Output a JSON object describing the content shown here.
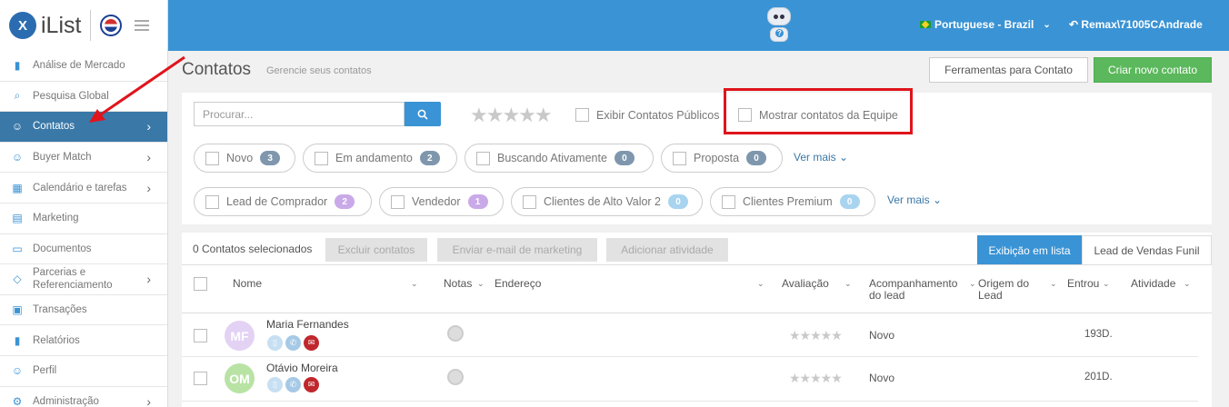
{
  "brand": {
    "logo_text": "iList",
    "logo_mark": "X"
  },
  "topbar": {
    "language": "Portuguese - Brazil",
    "user": "Remax\\71005CAndrade",
    "accent": "#3a93d4"
  },
  "sidebar": {
    "items": [
      {
        "label": "Análise de Mercado",
        "icon": "bar-chart-icon",
        "has_arrow": false
      },
      {
        "label": "Pesquisa Global",
        "icon": "search-icon",
        "has_arrow": false
      },
      {
        "label": "Contatos",
        "icon": "contacts-icon",
        "has_arrow": true,
        "active": true
      },
      {
        "label": "Buyer Match",
        "icon": "user-icon",
        "has_arrow": true
      },
      {
        "label": "Calendário e tarefas",
        "icon": "calendar-icon",
        "has_arrow": true
      },
      {
        "label": "Marketing",
        "icon": "newspaper-icon",
        "has_arrow": false
      },
      {
        "label": "Documentos",
        "icon": "folder-icon",
        "has_arrow": false
      },
      {
        "label": "Parcerias e Referenciamento",
        "icon": "tag-icon",
        "has_arrow": true
      },
      {
        "label": "Transações",
        "icon": "briefcase-icon",
        "has_arrow": false
      },
      {
        "label": "Relatórios",
        "icon": "bar-chart-icon",
        "has_arrow": false
      },
      {
        "label": "Perfil",
        "icon": "user-icon",
        "has_arrow": false
      },
      {
        "label": "Administração",
        "icon": "gear-icon",
        "has_arrow": true
      }
    ]
  },
  "page": {
    "title": "Contatos",
    "subtitle": "Gerencie seus contatos",
    "tools_button": "Ferramentas para Contato",
    "new_button": "Criar novo contato"
  },
  "filters": {
    "search_placeholder": "Procurar...",
    "stars": "★★★★★",
    "show_public": "Exibir Contatos Públicos",
    "show_team": "Mostrar contatos da Equipe",
    "row1": [
      {
        "label": "Novo",
        "count": "3",
        "color": "#7f97ad"
      },
      {
        "label": "Em andamento",
        "count": "2",
        "color": "#7f97ad"
      },
      {
        "label": "Buscando Ativamente",
        "count": "0",
        "color": "#7f97ad"
      },
      {
        "label": "Proposta",
        "count": "0",
        "color": "#7f97ad"
      }
    ],
    "row2": [
      {
        "label": "Lead de Comprador",
        "count": "2",
        "color": "#c9a9e8"
      },
      {
        "label": "Vendedor",
        "count": "1",
        "color": "#c9a9e8"
      },
      {
        "label": "Clientes de Alto Valor 2",
        "count": "0",
        "color": "#a9d4ef"
      },
      {
        "label": "Clientes Premium",
        "count": "0",
        "color": "#a9d4ef"
      }
    ],
    "more1": "Ver mais",
    "more2": "Ver mais"
  },
  "table": {
    "selected": "0 Contatos selecionados",
    "delete_btn": "Excluir contatos",
    "email_btn": "Enviar e-mail de marketing",
    "activity_btn": "Adicionar atividade",
    "view_list": "Exibição em lista",
    "view_funnel": "Lead de Vendas Funil",
    "headers": {
      "name": "Nome",
      "notes": "Notas",
      "address": "Endereço",
      "rating": "Avaliação",
      "followup": "Acompanhamento do lead",
      "origin": "Origem do Lead",
      "entered": "Entrou",
      "activity": "Atividade"
    },
    "rows": [
      {
        "initials": "MF",
        "name": "Maria Fernandes",
        "avatar_color": "#e3d2f4",
        "stars": "★★★★★",
        "stage": "Novo",
        "days": "193D."
      },
      {
        "initials": "OM",
        "name": "Otávio Moreira",
        "avatar_color": "#b9e3a5",
        "stars": "★★★★★",
        "stage": "Novo",
        "days": "201D."
      }
    ]
  }
}
